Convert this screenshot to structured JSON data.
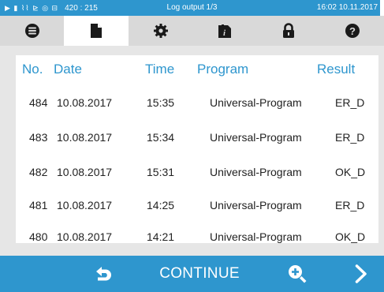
{
  "statusbar": {
    "indicators": "▶ ▮ ⌇⌇ ⊵ ◎ ⊟",
    "coords": "420 : 215",
    "title": "Log output 1/3",
    "datetime": "16:02  10.11.2017"
  },
  "tabs": [
    {
      "name": "menu",
      "icon": "database-icon"
    },
    {
      "name": "log",
      "icon": "document-icon",
      "active": true
    },
    {
      "name": "settings",
      "icon": "gear-icon"
    },
    {
      "name": "info",
      "icon": "info-document-icon"
    },
    {
      "name": "lock",
      "icon": "lock-icon"
    },
    {
      "name": "help",
      "icon": "help-icon"
    }
  ],
  "table": {
    "headers": {
      "no": "No.",
      "date": "Date",
      "time": "Time",
      "program": "Program",
      "result": "Result"
    },
    "rows": [
      {
        "no": "484",
        "date": "10.08.2017",
        "time": "15:35",
        "program": "Universal-Program",
        "result": "ER_D"
      },
      {
        "no": "483",
        "date": "10.08.2017",
        "time": "15:34",
        "program": "Universal-Program",
        "result": "ER_D"
      },
      {
        "no": "482",
        "date": "10.08.2017",
        "time": "15:31",
        "program": "Universal-Program",
        "result": "OK_D"
      },
      {
        "no": "481",
        "date": "10.08.2017",
        "time": "14:25",
        "program": "Universal-Program",
        "result": "ER_D"
      },
      {
        "no": "480",
        "date": "10.08.2017",
        "time": "14:21",
        "program": "Universal-Program",
        "result": "OK_D"
      }
    ]
  },
  "bottombar": {
    "continue_label": "CONTINUE",
    "back_icon": "back-arrow-icon",
    "zoom_icon": "zoom-in-icon",
    "next_icon": "chevron-right-icon"
  },
  "colors": {
    "accent": "#2e96ce",
    "tabbar": "#d9d9d9",
    "background": "#e6e6e6"
  }
}
